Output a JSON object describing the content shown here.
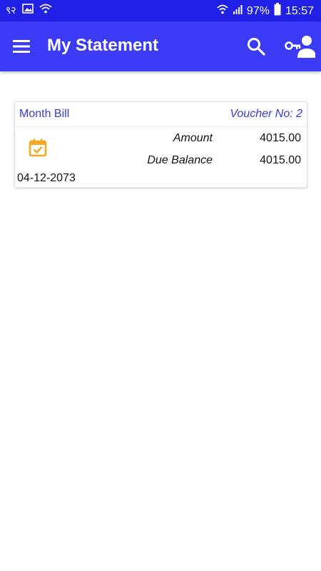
{
  "status_bar": {
    "carrier_text": "९२",
    "battery": "97%",
    "time": "15:57"
  },
  "app_bar": {
    "title": "My Statement",
    "menu_icon": "hamburger-menu-icon",
    "search_icon": "search-icon",
    "account_icon": "user-key-icon"
  },
  "statement": {
    "items": [
      {
        "type": "Month Bill",
        "voucher": "Voucher No: 2",
        "amount_label": "Amount",
        "amount": "4015.00",
        "due_label": "Due Balance",
        "due": "4015.00",
        "date": "04-12-2073",
        "icon": "calendar-check-icon"
      }
    ]
  },
  "colors": {
    "status_bar": "#2020e6",
    "app_bar": "#3b3bf5",
    "accent_text": "#3838d8",
    "calendar_icon": "#f5a623"
  }
}
